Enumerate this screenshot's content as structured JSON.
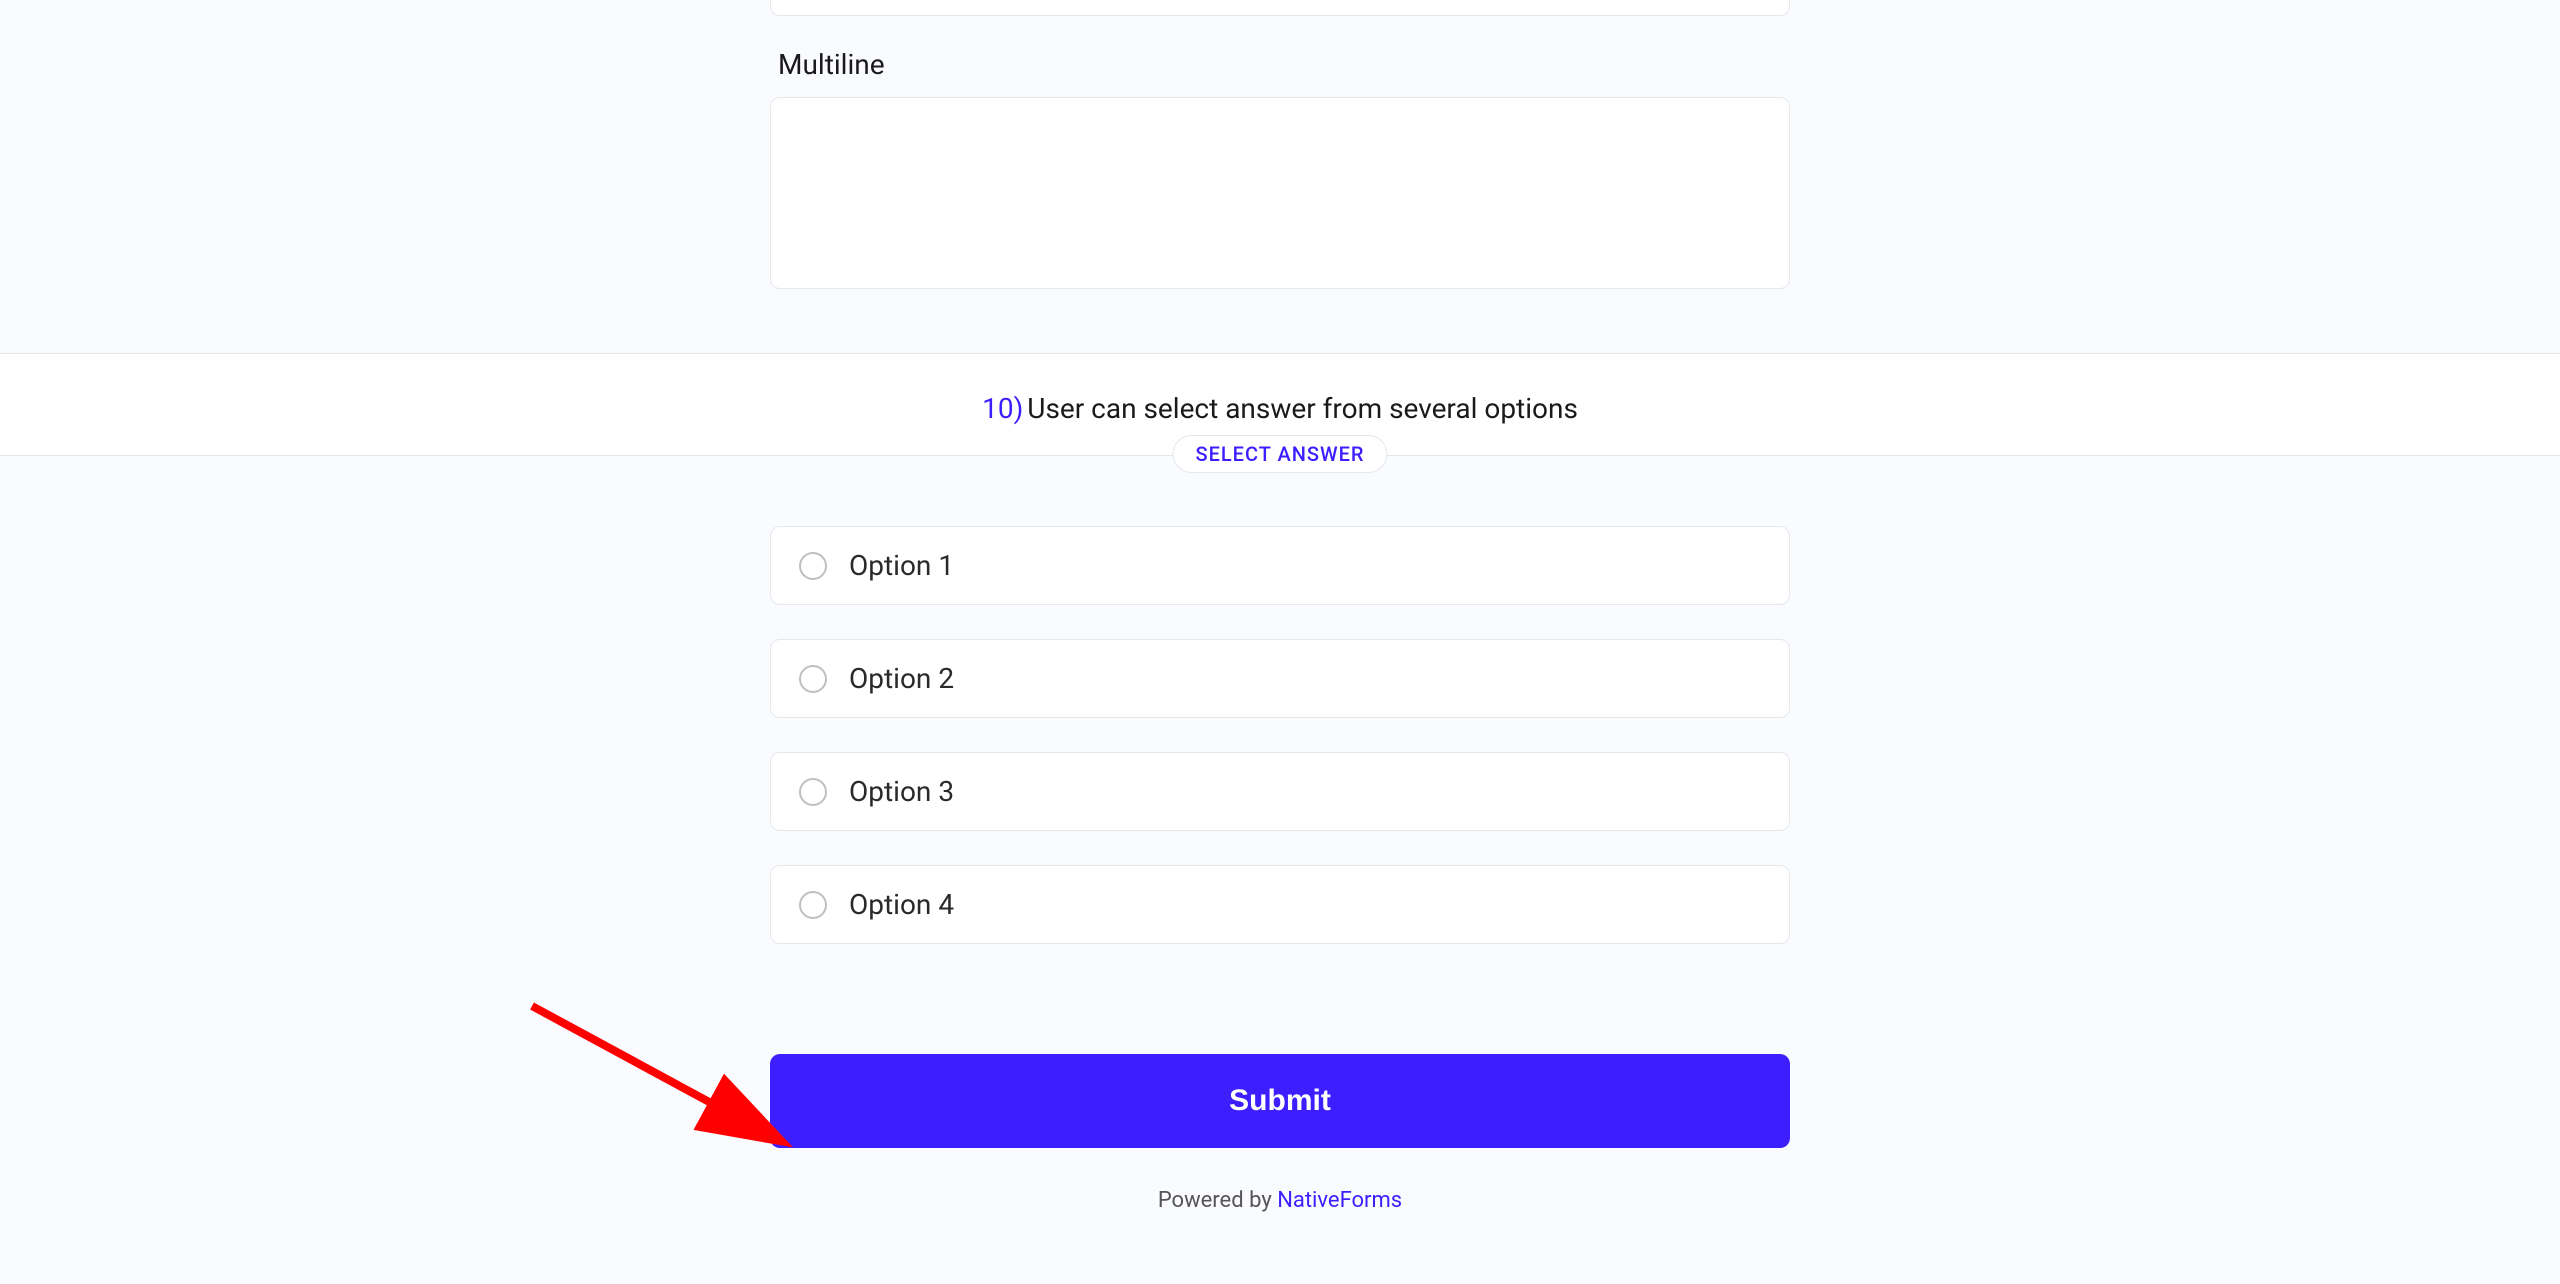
{
  "multiline": {
    "label": "Multiline"
  },
  "question10": {
    "number": "10)",
    "text": "User can select answer from several options",
    "badge": "SELECT ANSWER",
    "options": [
      "Option 1",
      "Option 2",
      "Option 3",
      "Option 4"
    ]
  },
  "submit": {
    "label": "Submit"
  },
  "footer": {
    "prefix": "Powered by ",
    "link_text": "NativeForms"
  }
}
